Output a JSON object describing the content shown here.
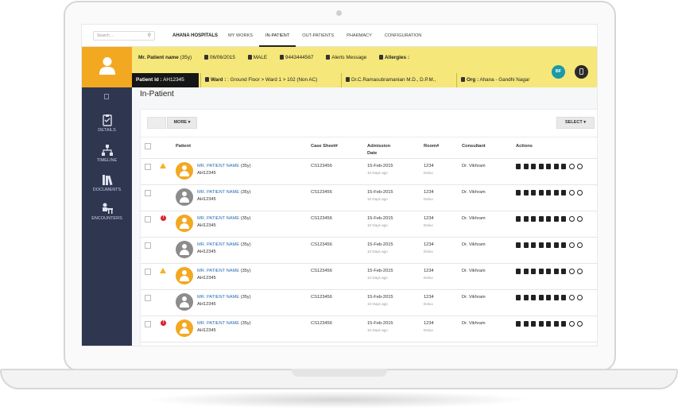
{
  "app": {
    "search_placeholder": "Search ...",
    "brand": "AHANA HOSPITALS",
    "nav": [
      "MY WORKS",
      "IN-PATIENT",
      "OUT-PATIENTS",
      "PHARMACY",
      "CONFIGURATION"
    ],
    "active_nav": "IN-PATIENT"
  },
  "sidebar": {
    "items": [
      {
        "label": "DETAILS",
        "icon": "clipboard-icon"
      },
      {
        "label": "TIMELINE",
        "icon": "sitemap-icon"
      },
      {
        "label": "DOCUMENTS",
        "icon": "books-icon"
      },
      {
        "label": "ENCOUNTERS",
        "icon": "encounter-icon"
      }
    ]
  },
  "patient": {
    "name": "Mr. Patient name",
    "age": "(35y)",
    "dob": "06/06/2015",
    "gender": "MALE",
    "phone": "9443444567",
    "alerts": "Alerts Message",
    "allergies": "Allergies :",
    "id_label": "Patient Id :",
    "id_value": "AH12345",
    "ward_label": "Ward :",
    "ward_value": ": Ground Floor > Ward 1 > 102 (Non AC)",
    "doctor": "Dr.C.Ramasubramanian M.D., D.P.M.,",
    "org_label": "Org :",
    "org_value": "Ahana - Gandhi Nagar",
    "badge": "BF"
  },
  "page": {
    "title": "In-Patient",
    "more_label": "MORE",
    "select_label": "SELECT"
  },
  "table": {
    "headers": {
      "patient": "Patient",
      "case_sheet": "Case Sheet#",
      "admission_line1": "Admission",
      "admission_line2": "Date",
      "room": "Room#",
      "consultant": "Consultant",
      "actions": "Actions"
    },
    "rows": [
      {
        "alert": "warning",
        "avatar": "orange",
        "name": "MR. PATIENT NAME",
        "age": "(35y)",
        "id": "AH12345",
        "case": "CS123456",
        "date": "15-Feb-2015",
        "ago": "10 Days ago",
        "room": "1234",
        "room_type": "Delux",
        "consultant": "Dr. Vikhram"
      },
      {
        "alert": "none",
        "avatar": "grey",
        "name": "MR. PATIENT NAME",
        "age": "(35y)",
        "id": "AH12345",
        "case": "CS123456",
        "date": "15-Feb-2015",
        "ago": "10 Days ago",
        "room": "1234",
        "room_type": "Delux",
        "consultant": "Dr. Vikhram"
      },
      {
        "alert": "error",
        "avatar": "orange",
        "name": "MR. PATIENT NAME",
        "age": "(35y)",
        "id": "AH12345",
        "case": "CS123456",
        "date": "15-Feb-2015",
        "ago": "10 Days ago",
        "room": "1234",
        "room_type": "Delux",
        "consultant": "Dr. Vikhram"
      },
      {
        "alert": "none",
        "avatar": "grey",
        "name": "MR. PATIENT NAME",
        "age": "(35y)",
        "id": "AH12345",
        "case": "CS123456",
        "date": "15-Feb-2015",
        "ago": "10 Days ago",
        "room": "1234",
        "room_type": "Delux",
        "consultant": "Dr. Vikhram"
      },
      {
        "alert": "warning",
        "avatar": "orange",
        "name": "MR. PATIENT NAME",
        "age": "(35y)",
        "id": "AH12345",
        "case": "CS123456",
        "date": "15-Feb-2015",
        "ago": "10 Days ago",
        "room": "1234",
        "room_type": "Delux",
        "consultant": "Dr. Vikhram"
      },
      {
        "alert": "none",
        "avatar": "grey",
        "name": "MR. PATIENT NAME",
        "age": "(35y)",
        "id": "AH12345",
        "case": "CS123456",
        "date": "15-Feb-2015",
        "ago": "10 Days ago",
        "room": "1234",
        "room_type": "Delux",
        "consultant": "Dr. Vikhram"
      },
      {
        "alert": "error",
        "avatar": "orange",
        "name": "MR. PATIENT NAME",
        "age": "(35y)",
        "id": "AH12345",
        "case": "CS123456",
        "date": "15-Feb-2015",
        "ago": "10 Days ago",
        "room": "1234",
        "room_type": "Delux",
        "consultant": "Dr. Vikhram"
      }
    ],
    "action_icons": [
      "print-icon",
      "transfer-icon",
      "group-icon",
      "notes-icon",
      "report-icon",
      "person-icon",
      "footsteps-icon",
      "info-icon",
      "money-icon"
    ]
  },
  "colors": {
    "accent_orange": "#f3a821",
    "patient_bar": "#f5e77a",
    "sidebar": "#2f3650",
    "link": "#2f6db5",
    "warning": "#f2b321",
    "error": "#d9232d",
    "avatar_grey": "#8c8c8c",
    "badge_teal": "#1a9aa8"
  }
}
